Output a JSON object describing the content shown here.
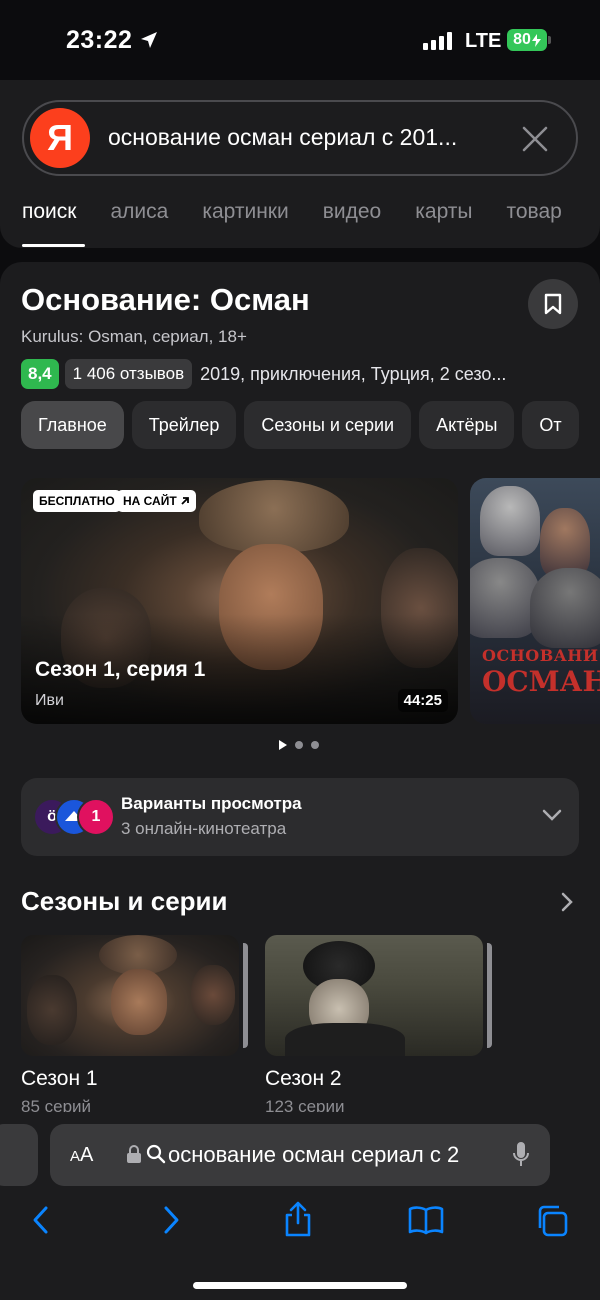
{
  "status": {
    "time": "23:22",
    "network": "LTE",
    "battery": "80"
  },
  "search": {
    "logo_letter": "Я",
    "query": "основание осман сериал с 201...",
    "tabs": [
      "поиск",
      "алиса",
      "картинки",
      "видео",
      "карты",
      "товар"
    ]
  },
  "film": {
    "title": "Основание: Осман",
    "subtitle": "Kurulus: Osman, сериал, 18+",
    "rating": "8,4",
    "reviews": "1 406 отзывов",
    "meta": "2019, приключения, Турция, 2 сезо...",
    "chips": [
      "Главное",
      "Трейлер",
      "Сезоны и серии",
      "Актёры",
      "От"
    ]
  },
  "video": {
    "badge_free": "БЕСПЛАТНО",
    "badge_site": "НА САЙТ",
    "episode": "Сезон 1, серия 1",
    "provider": "Иви",
    "duration": "44:25",
    "poster_line1": "ОСНОВАНИ",
    "poster_line2": "ОСМАН"
  },
  "options": {
    "title": "Варианты просмотра",
    "subtitle": "3 онлайн-кинотеатра",
    "logos": [
      "ö",
      "",
      "1"
    ]
  },
  "seasons": {
    "title": "Сезоны и серии",
    "items": [
      {
        "name": "Сезон 1",
        "count": "85 серий"
      },
      {
        "name": "Сезон 2",
        "count": "123 серии"
      }
    ]
  },
  "browser": {
    "aa_small": "A",
    "aa_big": "A",
    "url": "основание осман сериал с 2"
  }
}
